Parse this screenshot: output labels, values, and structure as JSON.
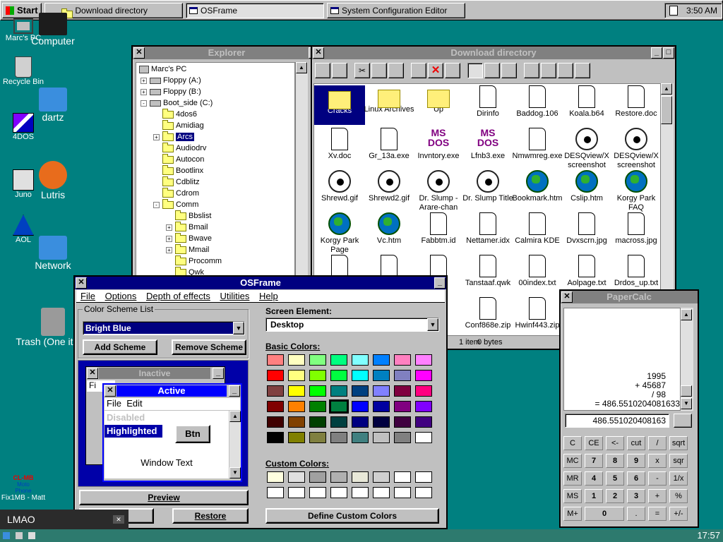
{
  "taskbar": {
    "start": "Start",
    "tasks": [
      "Download directory",
      "OSFrame",
      "System Configuration Editor"
    ],
    "clock": "3:50 AM"
  },
  "desktop_classic": [
    {
      "label": "Marc's PC",
      "icon": "computer-icon"
    },
    {
      "label": "Recycle Bin",
      "icon": "recycle-bin-icon"
    },
    {
      "label": "4DOS",
      "icon": "4dos-icon"
    },
    {
      "label": "Juno",
      "icon": "juno-icon"
    },
    {
      "label": "AOL",
      "icon": "aol-icon"
    }
  ],
  "desktop_modern": [
    {
      "label": "Computer",
      "icon": "monitor-icon"
    },
    {
      "label": "dartz",
      "icon": "home-folder-icon"
    },
    {
      "label": "Lutris",
      "icon": "lutris-icon"
    },
    {
      "label": "Network",
      "icon": "network-folder-icon"
    },
    {
      "label": "Trash (One item)",
      "icon": "trash-icon"
    }
  ],
  "desktop_bottom_left": {
    "logo_text": "CL-MB",
    "sub1": "Moto",
    "sub2": "Phone",
    "label": "Fix1MB - Matt"
  },
  "explorer": {
    "title": "Explorer",
    "tree": [
      {
        "label": "Marc's PC",
        "level": 0,
        "pm": ""
      },
      {
        "label": "Floppy (A:)",
        "level": 1,
        "pm": "+"
      },
      {
        "label": "Floppy (B:)",
        "level": 1,
        "pm": "+"
      },
      {
        "label": "Boot_side (C:)",
        "level": 1,
        "pm": "-"
      },
      {
        "label": "4dos6",
        "level": 2,
        "pm": ""
      },
      {
        "label": "Amidiag",
        "level": 2,
        "pm": ""
      },
      {
        "label": "Arcs",
        "level": 2,
        "pm": "+",
        "selected": true
      },
      {
        "label": "Audiodrv",
        "level": 2,
        "pm": ""
      },
      {
        "label": "Autocon",
        "level": 2,
        "pm": ""
      },
      {
        "label": "Bootlinx",
        "level": 2,
        "pm": ""
      },
      {
        "label": "Cdblitz",
        "level": 2,
        "pm": ""
      },
      {
        "label": "Cdrom",
        "level": 2,
        "pm": ""
      },
      {
        "label": "Comm",
        "level": 2,
        "pm": "-"
      },
      {
        "label": "Bbslist",
        "level": 3,
        "pm": ""
      },
      {
        "label": "Bmail",
        "level": 3,
        "pm": "+"
      },
      {
        "label": "Bwave",
        "level": 3,
        "pm": "+"
      },
      {
        "label": "Mmail",
        "level": 3,
        "pm": "+"
      },
      {
        "label": "Procomm",
        "level": 3,
        "pm": ""
      },
      {
        "label": "Qwk",
        "level": 3,
        "pm": ""
      }
    ]
  },
  "download": {
    "title": "Download directory",
    "status_items": "1 item",
    "status_bytes": "0 bytes",
    "files": [
      {
        "name": "Cracks",
        "type": "folder",
        "sel": true
      },
      {
        "name": "Linux Archives",
        "type": "folder"
      },
      {
        "name": "Up",
        "type": "folder"
      },
      {
        "name": "Dirinfo",
        "type": "doc"
      },
      {
        "name": "Baddog.106",
        "type": "doc"
      },
      {
        "name": "Koala.b64",
        "type": "zip"
      },
      {
        "name": "Restore.doc",
        "type": "doc"
      },
      {
        "name": "Xv.doc",
        "type": "doc"
      },
      {
        "name": "Gr_13a.exe",
        "type": "exe"
      },
      {
        "name": "Invntory.exe",
        "type": "ms"
      },
      {
        "name": "Lfnb3.exe",
        "type": "ms"
      },
      {
        "name": "Nmwmreg.exe",
        "type": "exe2"
      },
      {
        "name": "DESQview/X screenshot",
        "type": "eye"
      },
      {
        "name": "DESQview/X screenshot",
        "type": "eye"
      },
      {
        "name": "Shrewd.gif",
        "type": "eye"
      },
      {
        "name": "Shrewd2.gif",
        "type": "eye"
      },
      {
        "name": "Dr. Slump - Arare-chan",
        "type": "eye"
      },
      {
        "name": "Dr. Slump Title",
        "type": "eye"
      },
      {
        "name": "Bookmark.htm",
        "type": "globe"
      },
      {
        "name": "Cslip.htm",
        "type": "globe"
      },
      {
        "name": "Korgy Park FAQ",
        "type": "globe"
      },
      {
        "name": "Korgy Park Page",
        "type": "globe"
      },
      {
        "name": "Vc.htm",
        "type": "globe"
      },
      {
        "name": "Fabbtm.id",
        "type": "doc"
      },
      {
        "name": "Nettamer.idx",
        "type": "doc"
      },
      {
        "name": "Calmira KDE",
        "type": "img"
      },
      {
        "name": "Dvxscrn.jpg",
        "type": "img"
      },
      {
        "name": "macross.jpg",
        "type": "img"
      },
      {
        "name": "",
        "type": "img"
      },
      {
        "name": "",
        "type": "img"
      },
      {
        "name": "wk",
        "type": "doc"
      },
      {
        "name": "Tanstaaf.qwk",
        "type": "doc"
      },
      {
        "name": "00index.txt",
        "type": "txt"
      },
      {
        "name": "Aolpage.txt",
        "type": "txt"
      },
      {
        "name": "Drdos_up.txt",
        "type": "txt"
      },
      {
        "name": "",
        "type": "none"
      },
      {
        "name": "",
        "type": "none"
      },
      {
        "name": "zip",
        "type": "none"
      },
      {
        "name": "Conf868e.zip",
        "type": "zip"
      },
      {
        "name": "Hwinf443.zip",
        "type": "zip"
      }
    ]
  },
  "osframe": {
    "title": "OSFrame",
    "menu": [
      "File",
      "Options",
      "Depth of effects",
      "Utilities",
      "Help"
    ],
    "scheme_group": "Color Scheme List",
    "scheme_value": "Bright Blue",
    "add_scheme": "Add Scheme",
    "remove_scheme": "Remove Scheme",
    "preview": {
      "inactive": "Inactive",
      "active": "Active",
      "file": "File",
      "edit": "Edit",
      "disabled": "Disabled",
      "highlighted": "Highlighted",
      "btn": "Btn",
      "window_text": "Window Text",
      "f_cut": "Fi"
    },
    "preview_btn": "Preview",
    "restore_btn": "Restore",
    "screen_element_label": "Screen Element:",
    "screen_element_value": "Desktop",
    "basic_colors_label": "Basic Colors:",
    "basic_colors": [
      "#ff8080",
      "#ffffc0",
      "#80ff80",
      "#00ff80",
      "#80ffff",
      "#0080ff",
      "#ff80c0",
      "#ff80ff",
      "#ff0000",
      "#ffff80",
      "#80ff00",
      "#00ff40",
      "#00ffff",
      "#0080c0",
      "#8080c0",
      "#ff00ff",
      "#804040",
      "#ffff00",
      "#00ff00",
      "#008080",
      "#004080",
      "#8080ff",
      "#800040",
      "#ff0080",
      "#800000",
      "#ff8000",
      "#008000",
      "#008040",
      "#0000ff",
      "#0000a0",
      "#800080",
      "#8000ff",
      "#400000",
      "#804000",
      "#004000",
      "#004040",
      "#000080",
      "#000040",
      "#400040",
      "#400080",
      "#000000",
      "#808000",
      "#808040",
      "#808080",
      "#408080",
      "#c0c0c0",
      "#808080",
      "#ffffff"
    ],
    "custom_colors_label": "Custom Colors:",
    "custom_colors": [
      "#ffffe0",
      "#e0e0e0",
      "#a0a0a0",
      "#b0b0b0",
      "#e8e8d8",
      "#d0d0d0",
      "#ffffff",
      "#ffffff",
      "#ffffff",
      "#ffffff",
      "#ffffff",
      "#ffffff",
      "#ffffff",
      "#ffffff",
      "#ffffff",
      "#ffffff"
    ],
    "define_custom": "Define Custom Colors"
  },
  "papercalc": {
    "title": "PaperCalc",
    "tape": [
      "1995",
      "+ 45687",
      "/ 98",
      "= 486.5510204081633"
    ],
    "display": "486.551020408163",
    "rows": [
      [
        "C",
        "CE",
        "<-",
        "cut",
        "/",
        "sqrt"
      ],
      [
        "MC",
        "7",
        "8",
        "9",
        "x",
        "sqr"
      ],
      [
        "MR",
        "4",
        "5",
        "6",
        "-",
        "1/x"
      ],
      [
        "MS",
        "1",
        "2",
        "3",
        "+",
        "%"
      ],
      [
        "M+",
        "0",
        ".",
        "=",
        "+/-"
      ]
    ]
  },
  "search": {
    "value": "LMAO"
  },
  "bottom_clock": "17:57"
}
